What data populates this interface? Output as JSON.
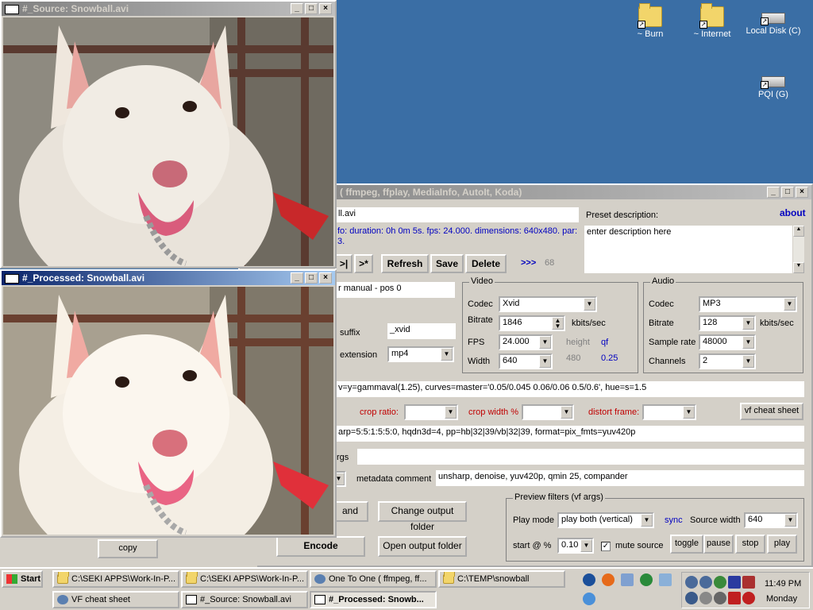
{
  "desktop": {
    "icons": [
      {
        "label": "~ Burn",
        "type": "folder"
      },
      {
        "label": "~ Internet",
        "type": "folder"
      },
      {
        "label": "Local Disk (C)",
        "type": "drive"
      },
      {
        "label": "PQI (G)",
        "type": "drive"
      }
    ]
  },
  "source_window": {
    "title": "#_Source: Snowball.avi"
  },
  "processed_window": {
    "title": "#_Processed: Snowball.avi"
  },
  "main_window": {
    "title": "( ffmpeg, ffplay, MediaInfo, AutoIt, Koda)",
    "file_name": "ll.avi",
    "info_line1": "fo: duration: 0h 0m 5s. fps: 24.000. dimensions: 640x480. par:",
    "info_line2": "3.",
    "nav_buttons": [
      ">|",
      ">*"
    ],
    "refresh": "Refresh",
    "save": "Save",
    "delete": "Delete",
    "arrows": ">>>",
    "preset_number": "68",
    "preset_description_label": "Preset description:",
    "about": "about",
    "preset_description": "enter description here",
    "mode_field": "r manual - pos 0",
    "suffix_label": "suffix",
    "suffix_value": "_xvid",
    "extension_label": "extension",
    "extension_value": "mp4",
    "video": {
      "title": "Video",
      "codec_label": "Codec",
      "codec": "Xvid",
      "bitrate_label": "Bitrate",
      "bitrate": "1846",
      "bitrate_unit": "kbits/sec",
      "fps_label": "FPS",
      "fps": "24.000",
      "width_label": "Width",
      "width": "640",
      "height_label": "height",
      "height": "480",
      "qf_label": "qf",
      "qf": "0.25"
    },
    "audio": {
      "title": "Audio",
      "codec_label": "Codec",
      "codec": "MP3",
      "bitrate_label": "Bitrate",
      "bitrate": "128",
      "bitrate_unit": "kbits/sec",
      "sample_rate_label": "Sample rate",
      "sample_rate": "48000",
      "channels_label": "Channels",
      "channels": "2"
    },
    "vf_line": "v=y=gammaval(1.25), curves=master='0.05/0.045 0.06/0.06 0.5/0.6', hue=s=1.5",
    "crop_ratio_label": "crop ratio:",
    "crop_width_label": "crop width %",
    "distort_frame_label": "distort frame:",
    "vf_cheat_sheet": "vf cheat sheet",
    "filter_line": "arp=5:5:1:5:5:0, hqdn3d=4, pp=hb|32|39/vb|32|39, format=pix_fmts=yuv420p",
    "args_label": "rgs",
    "metadata_comment_label": "metadata comment",
    "metadata_comment": "unsharp, denoise, yuv420p, qmin 25, compander",
    "and_button": "and",
    "change_output_folder": "Change output folder",
    "encode": "Encode",
    "open_output_folder": "Open output folder",
    "copy": "copy",
    "preview": {
      "title": "Preview filters (vf args)",
      "play_mode_label": "Play mode",
      "play_mode": "play both (vertical)",
      "sync": "sync",
      "source_width_label": "Source width",
      "source_width": "640",
      "start_label": "start @ %",
      "start_value": "0.10",
      "mute_source": "mute source",
      "toggle": "toggle",
      "pause": "pause",
      "stop": "stop",
      "play": "play"
    }
  },
  "taskbar": {
    "start": "Start",
    "buttons_row1": [
      "C:\\SEKI APPS\\Work-In-P...",
      "C:\\SEKI APPS\\Work-In-P...",
      "One To One ( ffmpeg, ff...",
      "C:\\TEMP\\snowball"
    ],
    "buttons_row2": [
      "VF cheat sheet",
      "#_Source: Snowball.avi",
      "#_Processed: Snowb..."
    ],
    "clock_time": "11:49 PM",
    "clock_day": "Monday"
  }
}
